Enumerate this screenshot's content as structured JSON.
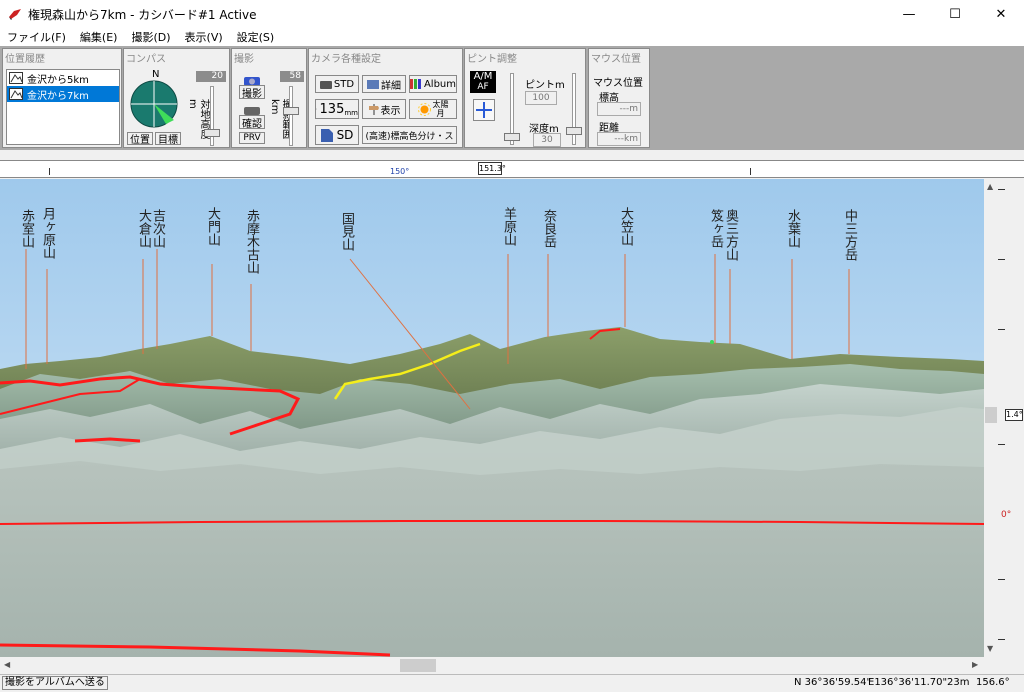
{
  "window": {
    "title": "権現森山から7km - カシバード#1 Active",
    "min": "—",
    "max": "☐",
    "close": "✕"
  },
  "menu": [
    "ファイル(F)",
    "編集(E)",
    "撮影(D)",
    "表示(V)",
    "設定(S)"
  ],
  "history": {
    "title": "位置履歴",
    "items": [
      "金沢から5km",
      "金沢から7km"
    ],
    "selected": 1
  },
  "compass": {
    "title": "コンパス",
    "north": "N",
    "btn_position": "位置",
    "btn_target": "目標",
    "height_label": "対地高度 m",
    "height_value": "20"
  },
  "shoot": {
    "title": "撮影",
    "btn_shoot": "撮影",
    "btn_check": "確認",
    "btn_prv": "PRV",
    "range_label": "撮影範囲 km",
    "range_value": "58"
  },
  "camera": {
    "title": "カメラ各種設定",
    "btn_std": "STD",
    "btn_detail": "詳細",
    "btn_album": "Album",
    "btn_135": "135",
    "btn_135_unit": "mm",
    "btn_show": "表示",
    "btn_sunmoon_1": "太陽",
    "btn_sunmoon_2": "月",
    "btn_sd": "SD",
    "btn_color": "(高速)標高色分け・ス"
  },
  "focus": {
    "title": "ピント調整",
    "am": "A/M",
    "af": "AF",
    "focus_label": "ピントm",
    "focus_value": "100",
    "depth_label": "深度m",
    "depth_value": "30"
  },
  "mouse": {
    "title": "マウス位置",
    "sub": "マウス位置",
    "elev_label": "標高",
    "elev_value": "---m",
    "dist_label": "距離",
    "dist_value": "---km"
  },
  "ruler": {
    "label_150": "150°",
    "marker": "151.3°"
  },
  "mountains": [
    "赤室山",
    "月ヶ原山",
    "大倉山",
    "吉次山",
    "大門山",
    "赤摩木古山",
    "国見山",
    "羊原山",
    "奈良岳",
    "大笠山",
    "笈ヶ岳",
    "奥三方山",
    "水葉山",
    "中三方岳"
  ],
  "side_scale": {
    "value": "1.4°",
    "zero": "0°"
  },
  "status": {
    "album": "撮影をアルバムへ送る",
    "north": "N 36°36'59.54\"",
    "east": "E136°36'11.70\"",
    "alt": "23m",
    "angle": "156.6°"
  },
  "colors": {
    "sky_top": "#9fc9ec",
    "sky_bottom": "#d7e9f7",
    "route_red": "#ff1a1a",
    "route_yellow": "#f5ee1a",
    "selected": "#0078d7"
  }
}
